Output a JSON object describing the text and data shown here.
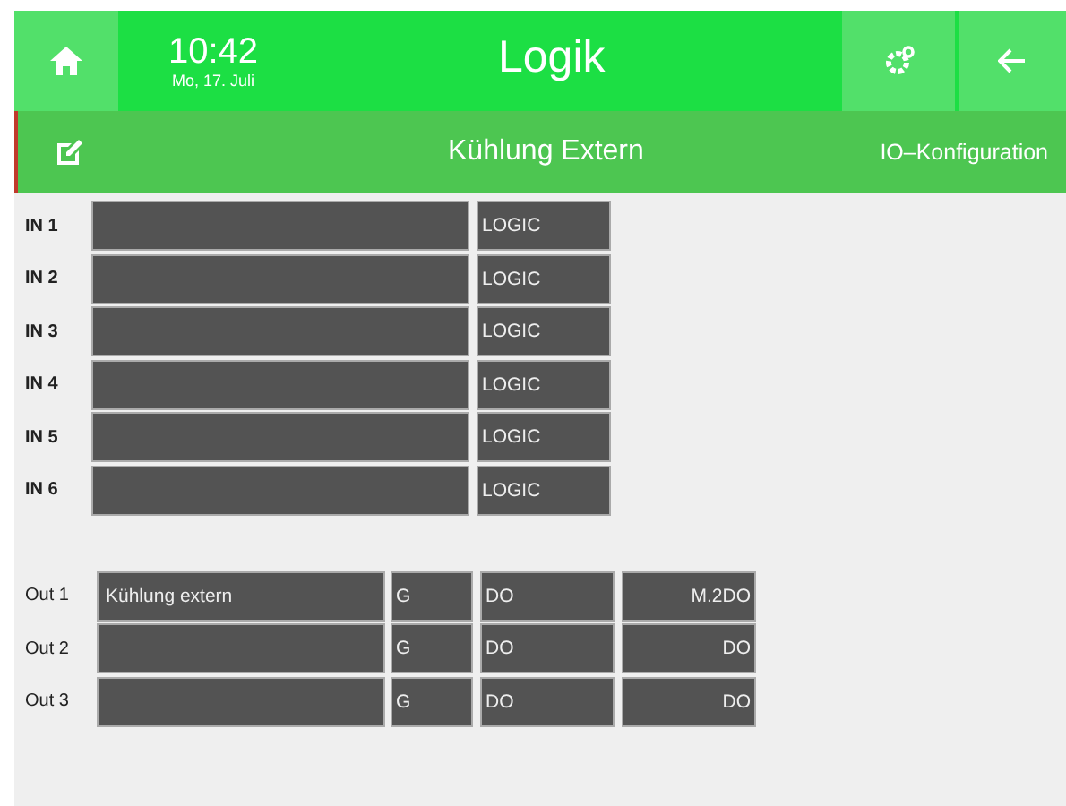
{
  "header": {
    "time": "10:42",
    "date": "Mo, 17. Juli",
    "title": "Logik"
  },
  "subheader": {
    "title": "Kühlung Extern",
    "link": "IO–Konfiguration"
  },
  "inputs": [
    {
      "label": "IN 1",
      "type": "LOGIC"
    },
    {
      "label": "IN 2",
      "type": "LOGIC"
    },
    {
      "label": "IN 3",
      "type": "LOGIC"
    },
    {
      "label": "IN 4",
      "type": "LOGIC"
    },
    {
      "label": "IN 5",
      "type": "LOGIC"
    },
    {
      "label": "IN 6",
      "type": "LOGIC"
    }
  ],
  "outputs": [
    {
      "label": "Out 1",
      "value": "Kühlung extern",
      "group": "G",
      "type": "DO",
      "target": "M.2DO"
    },
    {
      "label": "Out 2",
      "group": "G",
      "type": "DO",
      "target": "DO"
    },
    {
      "label": "Out 3",
      "group": "G",
      "type": "DO",
      "target": "DO"
    }
  ]
}
